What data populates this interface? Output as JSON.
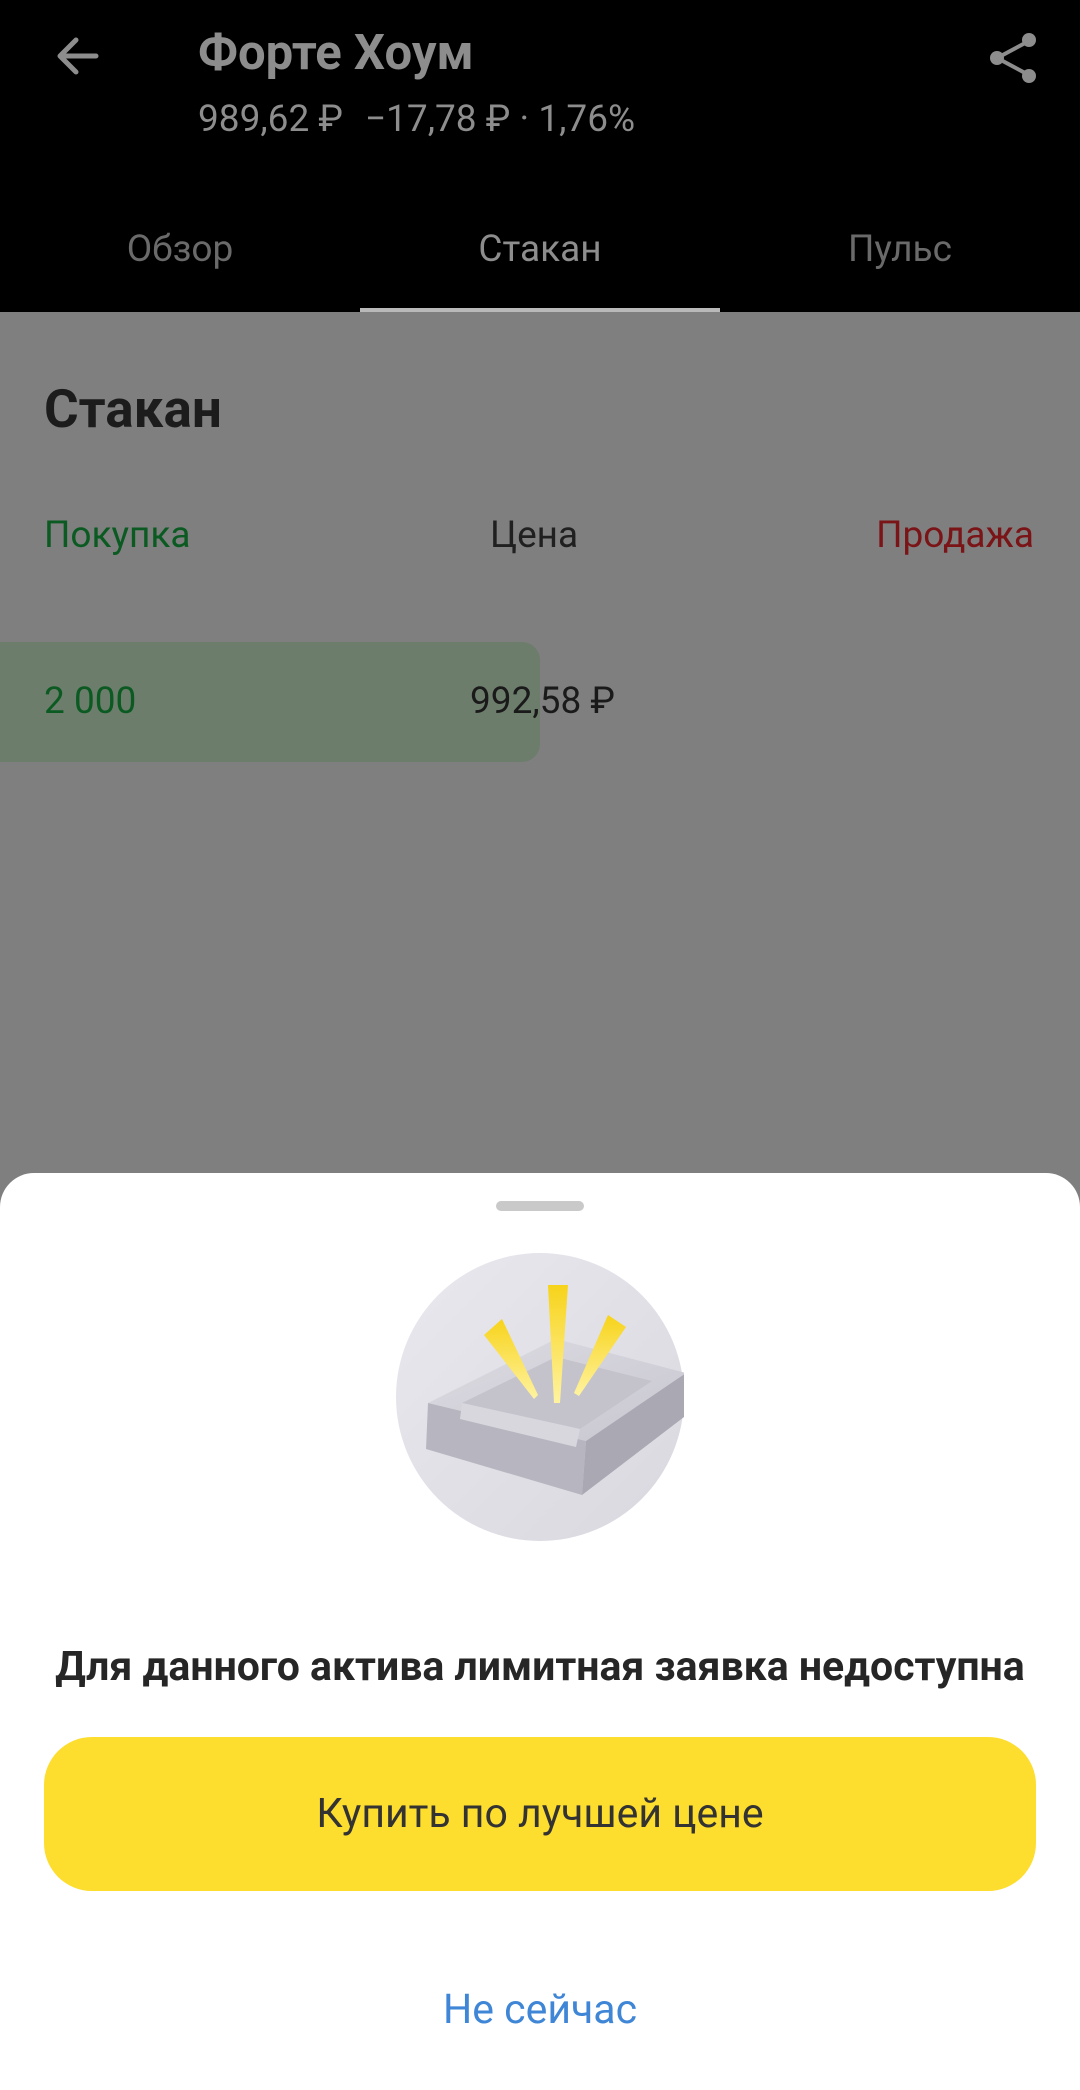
{
  "header": {
    "title": "Форте Хоум",
    "price": "989,62 ₽",
    "change": "−17,78 ₽ · 1,76%",
    "back_icon": "arrow-left-icon",
    "share_icon": "share-icon"
  },
  "tabs": [
    {
      "label": "Обзор",
      "active": false
    },
    {
      "label": "Стакан",
      "active": true
    },
    {
      "label": "Пульс",
      "active": false
    }
  ],
  "order_book": {
    "title": "Стакан",
    "columns": {
      "buy": "Покупка",
      "price": "Цена",
      "sell": "Продажа"
    },
    "rows": [
      {
        "buy_qty": "2 000",
        "price": "992,58 ₽",
        "sell_qty": ""
      }
    ]
  },
  "sheet": {
    "illustration": "empty-tray-icon",
    "message": "Для данного актива лимитная заявка недоступна",
    "primary_button": "Купить по лучшей цене",
    "secondary_button": "Не сейчас"
  },
  "colors": {
    "accent_yellow": "#fddd2d",
    "link_blue": "#3f86d6",
    "buy_green": "#0b5a22",
    "sell_red": "#7a1417",
    "overlay": "#7f7f7f"
  }
}
